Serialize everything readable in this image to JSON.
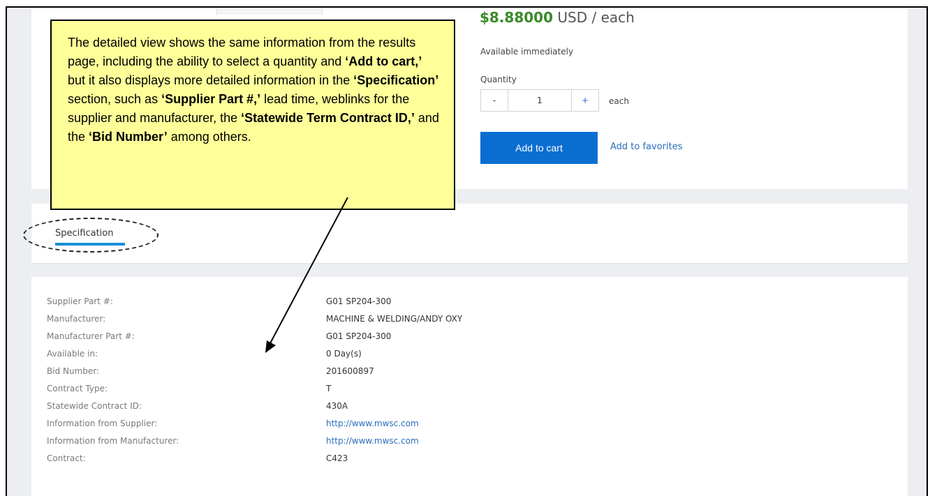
{
  "product": {
    "price_amount": "$8.88000",
    "price_unit": "USD / each",
    "availability": "Available immediately",
    "quantity_label": "Quantity",
    "quantity_value": "1",
    "quantity_minus": "-",
    "quantity_plus": "+",
    "unit": "each",
    "add_to_cart_label": "Add to cart",
    "add_to_favorites_label": "Add to favorites"
  },
  "tabs": [
    {
      "label": "Specification",
      "active": true
    }
  ],
  "specification": {
    "rows": [
      {
        "label": "Supplier Part #:",
        "value": "G01 SP204-300"
      },
      {
        "label": "Manufacturer:",
        "value": "MACHINE & WELDING/ANDY OXY"
      },
      {
        "label": "Manufacturer Part #:",
        "value": "G01 SP204-300"
      },
      {
        "label": "Available in:",
        "value": "0 Day(s)"
      },
      {
        "label": "Bid Number:",
        "value": "201600897"
      },
      {
        "label": "Contract Type:",
        "value": "T"
      },
      {
        "label": "Statewide Contract ID:",
        "value": "430A"
      },
      {
        "label": "Information from Supplier:",
        "value": "http://www.mwsc.com"
      },
      {
        "label": "Information from Manufacturer:",
        "value": "http://www.mwsc.com"
      },
      {
        "label": "Contract:",
        "value": "C423"
      }
    ]
  },
  "callout": {
    "t1": "The detailed view shows the same information from the results page, including the ability to select a quantity and ",
    "b1": "‘Add to cart,’",
    "t2": " but it also displays more detailed information in the ",
    "b2": "‘Specification’",
    "t3": " section, such as ",
    "b3": "‘Supplier Part #,’",
    "t4": " lead time, weblinks for the supplier and manufacturer, the ",
    "b4": "‘Statewide Term Contract ID,’",
    "t5": " and the ",
    "b5": "‘Bid Number’",
    "t6": " among others."
  },
  "colors": {
    "price_green": "#3a8a28",
    "primary_blue": "#0a6ed1",
    "link_blue": "#2a6ebb",
    "tab_underline": "#1a8fd6",
    "callout_fill": "#ffff99",
    "page_background": "#eceef1"
  }
}
